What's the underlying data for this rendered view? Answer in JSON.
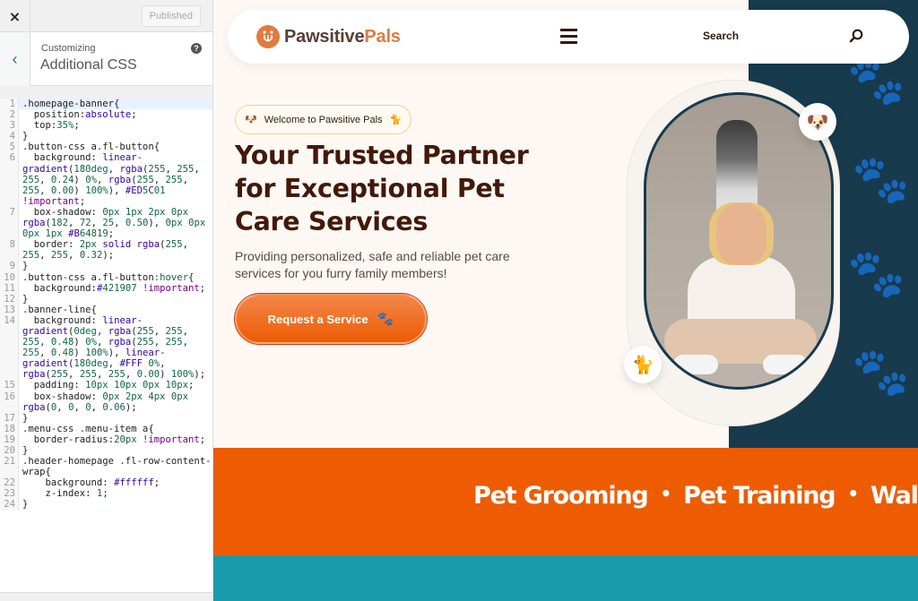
{
  "customizer": {
    "close_icon": "×",
    "published_label": "Published",
    "back_icon": "‹",
    "breadcrumb": "Customizing",
    "section_title": "Additional CSS",
    "help_icon": "?"
  },
  "css_editor": {
    "lines": [
      {
        "n": "1",
        "text": ".homepage-banner{"
      },
      {
        "n": "2",
        "text": "  position:absolute;"
      },
      {
        "n": "3",
        "text": "  top:35%;"
      },
      {
        "n": "4",
        "text": "}"
      },
      {
        "n": "5",
        "text": ".button-css a.fl-button{"
      },
      {
        "n": "6",
        "text": "  background: linear-gradient(180deg, rgba(255, 255, 255, 0.24) 0%, rgba(255, 255, 255, 0.00) 100%), #ED5C01 !important;"
      },
      {
        "n": "7",
        "text": "  box-shadow: 0px 1px 2px 0px rgba(182, 72, 25, 0.50), 0px 0px 0px 1px #B64819;"
      },
      {
        "n": "8",
        "text": "  border: 2px solid rgba(255, 255, 255, 0.32);"
      },
      {
        "n": "9",
        "text": "}"
      },
      {
        "n": "10",
        "text": ".button-css a.fl-button:hover{"
      },
      {
        "n": "11",
        "text": "  background:#421907 !important;"
      },
      {
        "n": "12",
        "text": "}"
      },
      {
        "n": "13",
        "text": ".banner-line{"
      },
      {
        "n": "14",
        "text": "  background: linear-gradient(0deg, rgba(255, 255, 255, 0.48) 0%, rgba(255, 255, 255, 0.48) 100%), linear-gradient(180deg, #FFF 0%, rgba(255, 255, 255, 0.00) 100%);"
      },
      {
        "n": "15",
        "text": "  padding: 10px 10px 0px 10px;"
      },
      {
        "n": "16",
        "text": "  box-shadow: 0px 2px 4px 0px rgba(0, 0, 0, 0.06);"
      },
      {
        "n": "17",
        "text": "}"
      },
      {
        "n": "18",
        "text": ".menu-css .menu-item a{"
      },
      {
        "n": "19",
        "text": "  border-radius:20px !important;"
      },
      {
        "n": "20",
        "text": "}"
      },
      {
        "n": "21",
        "text": ".header-homepage .fl-row-content-wrap{"
      },
      {
        "n": "22",
        "text": "    background: #ffffff;"
      },
      {
        "n": "23",
        "text": "    z-index: 1;"
      },
      {
        "n": "24",
        "text": "}"
      }
    ]
  },
  "site": {
    "logo_mark": "♉",
    "logo_part1": "Pawsitive",
    "logo_part2": "Pals",
    "menu_icon": "hamburger-menu",
    "search_label": "Search",
    "welcome": {
      "text": "Welcome to Pawsitive Pals",
      "emoji_left": "🐶",
      "emoji_right": "🐈"
    },
    "headline": "Your Trusted Partner for Exceptional Pet Care Services",
    "subtext": "Providing personalized, safe and reliable pet care services for you furry family members!",
    "cta_label": "Request a Service",
    "cta_icon": "🐾",
    "badge_dog": "🐶",
    "badge_cat": "🐈",
    "services": [
      "Pet Grooming",
      "Pet Training",
      "Walkin"
    ],
    "separator": "•",
    "colors": {
      "brand_orange": "#ED5C01",
      "brand_brown": "#421907",
      "navy": "#173A4D",
      "teal": "#1A9BAB",
      "cream": "#FDF8F4"
    }
  }
}
